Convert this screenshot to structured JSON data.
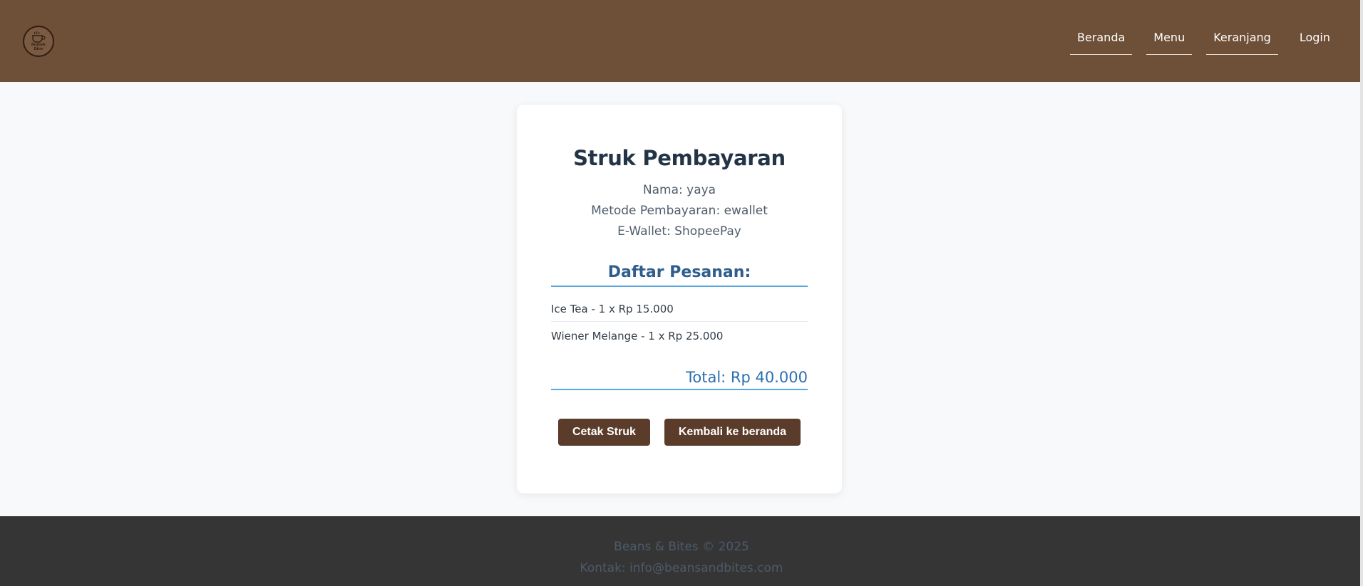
{
  "header": {
    "logo_text_line1": "Beans&",
    "logo_text_line2": "Bites",
    "nav": [
      {
        "label": "Beranda"
      },
      {
        "label": "Menu"
      },
      {
        "label": "Keranjang"
      },
      {
        "label": "Login"
      }
    ]
  },
  "receipt": {
    "title": "Struk Pembayaran",
    "name_line": "Nama: yaya",
    "method_line": "Metode Pembayaran: ewallet",
    "wallet_line": "E-Wallet: ShopeePay",
    "orders_title": "Daftar Pesanan:",
    "items": [
      {
        "text": "Ice Tea - 1 x Rp 15.000"
      },
      {
        "text": "Wiener Melange - 1 x Rp 25.000"
      }
    ],
    "total": "Total: Rp 40.000",
    "print_button": "Cetak Struk",
    "back_button": "Kembali ke beranda"
  },
  "footer": {
    "copyright": "Beans & Bites © 2025",
    "contact": "Kontak: info@beansandbites.com"
  },
  "colors": {
    "header_bg": "#6e4f37",
    "button_bg": "#5b3c2b",
    "accent_blue": "#5aa6de",
    "footer_bg": "#353535"
  },
  "icons": {
    "logo": "coffee-cup-icon"
  }
}
